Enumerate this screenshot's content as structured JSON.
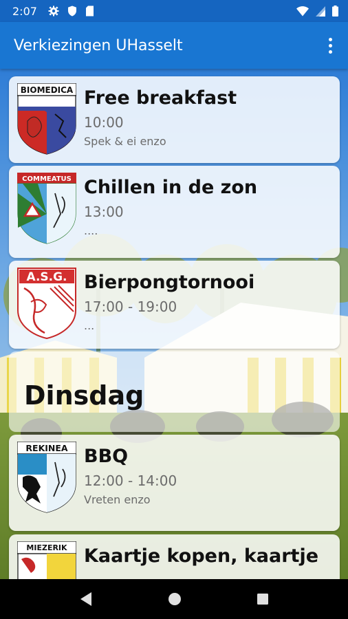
{
  "status_bar": {
    "time": "2:07",
    "icons_left": [
      "gear-icon",
      "shield-icon",
      "sd-card-icon"
    ],
    "icons_right": [
      "wifi-icon",
      "signal-icon",
      "battery-icon"
    ]
  },
  "app_bar": {
    "title": "Verkiezingen UHasselt",
    "menu_icon": "overflow-menu-icon"
  },
  "events": [
    {
      "logo_text": "BIOMEDICA",
      "title": "Free breakfast",
      "time": "10:00",
      "description": "Spek & ei enzo"
    },
    {
      "logo_text": "COMMEATUS",
      "title": "Chillen in de zon",
      "time": "13:00",
      "description": "...."
    },
    {
      "logo_text": "A.S.G.",
      "title": "Bierpongtornooi",
      "time": "17:00 - 19:00",
      "description": "..."
    }
  ],
  "day_header": {
    "label": "Dinsdag"
  },
  "events_day2": [
    {
      "logo_text": "REKINEA",
      "title": "BBQ",
      "time": "12:00 - 14:00",
      "description": "Vreten enzo"
    },
    {
      "logo_text": "MIEZERIK",
      "title": "Kaartje kopen, kaartje",
      "time": "",
      "description": ""
    }
  ],
  "nav_bar": {
    "buttons": [
      "back-icon",
      "home-icon",
      "recents-icon"
    ]
  },
  "colors": {
    "status_bar": "#1565c0",
    "app_bar": "#1976d2",
    "nav_bar": "#000000"
  }
}
